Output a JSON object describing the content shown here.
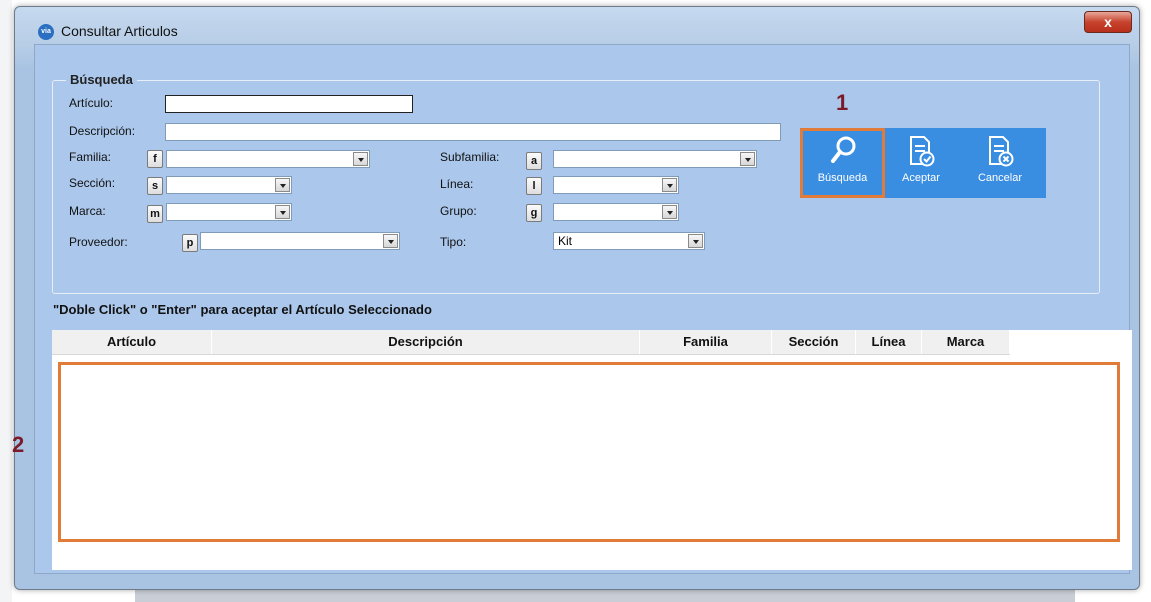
{
  "window": {
    "title": "Consultar Articulos",
    "app_icon_text": "via",
    "close_label": "x"
  },
  "search_group": {
    "legend": "Búsqueda",
    "articulo_label": "Artículo:",
    "articulo_value": "",
    "descripcion_label": "Descripción:",
    "descripcion_value": "",
    "familia_label": "Familia:",
    "familia_key": "f",
    "familia_value": "",
    "seccion_label": "Sección:",
    "seccion_key": "s",
    "seccion_value": "",
    "marca_label": "Marca:",
    "marca_key": "m",
    "marca_value": "",
    "proveedor_label": "Proveedor:",
    "proveedor_key": "p",
    "proveedor_value": "",
    "subfamilia_label": "Subfamilia:",
    "subfamilia_key": "a",
    "subfamilia_value": "",
    "linea_label": "Línea:",
    "linea_key": "l",
    "linea_value": "",
    "grupo_label": "Grupo:",
    "grupo_key": "g",
    "grupo_value": "",
    "tipo_label": "Tipo:",
    "tipo_value": "Kit"
  },
  "toolbar": {
    "search_label": "Búsqueda",
    "accept_label": "Aceptar",
    "cancel_label": "Cancelar"
  },
  "annotations": {
    "marker_1": "1",
    "marker_2": "2"
  },
  "results": {
    "hint": "\"Doble Click\" o \"Enter\" para aceptar el Artículo Seleccionado",
    "columns": [
      "Artículo",
      "Descripción",
      "Familia",
      "Sección",
      "Línea",
      "Marca"
    ],
    "rows": []
  },
  "colors": {
    "client_bg": "#abc8ec",
    "toolbar_bg": "#3a8ee2",
    "highlight": "#e07b39",
    "annotation": "#7b1b2a"
  }
}
